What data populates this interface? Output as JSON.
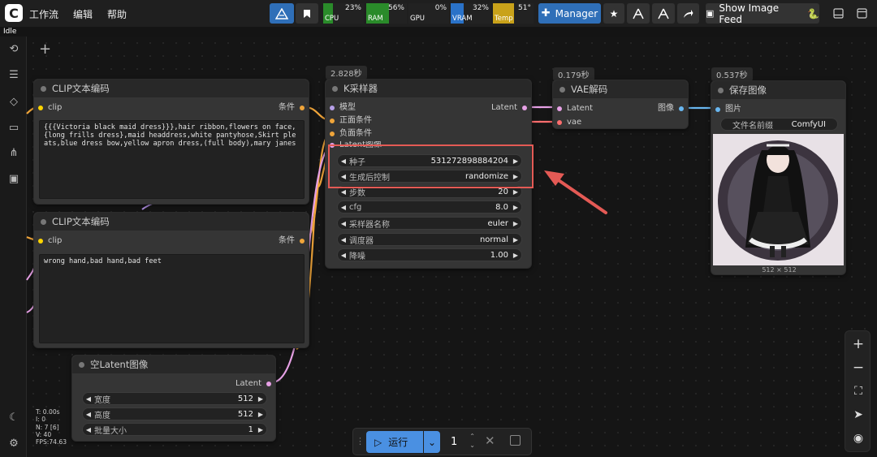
{
  "menu": [
    "工作流",
    "编辑",
    "帮助"
  ],
  "logo": "C",
  "status": "Idle",
  "resources": [
    {
      "label": "CPU",
      "pct": "23%",
      "fill": 0.23,
      "color": "#2a8b2a"
    },
    {
      "label": "RAM",
      "pct": "56%",
      "fill": 0.56,
      "color": "#2a8b2a"
    },
    {
      "label": "GPU",
      "pct": "0%",
      "fill": 0.0,
      "color": "#2a8b2a"
    },
    {
      "label": "VRAM",
      "pct": "32%",
      "fill": 0.32,
      "color": "#2a72c8"
    },
    {
      "label": "Temp",
      "pct": "51°",
      "fill": 0.51,
      "color": "#c9a21a"
    }
  ],
  "toolbar": {
    "manager_label": "Manager",
    "show_feed_label": "Show Image Feed",
    "feed_emoji": "🐍"
  },
  "nodes": {
    "clip1": {
      "title": "CLIP文本编码",
      "input": "clip",
      "output": "条件",
      "text": "{{{Victoria black maid dress}}},hair ribbon,flowers on face,{long frills dress},maid headdress,white pantyhose,Skirt pleats,blue dress bow,yellow apron dress,(full body),mary janes"
    },
    "clip2": {
      "title": "CLIP文本编码",
      "input": "clip",
      "output": "条件",
      "text": "wrong hand,bad hand,bad feet"
    },
    "ksampler": {
      "title": "K采样器",
      "time": "2.828秒",
      "inputs": [
        "模型",
        "正面条件",
        "负面条件",
        "Latent图像"
      ],
      "output": "Latent",
      "widgets": [
        {
          "label": "种子",
          "value": "531272898884204"
        },
        {
          "label": "生成后控制",
          "value": "randomize"
        },
        {
          "label": "步数",
          "value": "20"
        },
        {
          "label": "cfg",
          "value": "8.0"
        },
        {
          "label": "采样器名称",
          "value": "euler"
        },
        {
          "label": "调度器",
          "value": "normal"
        },
        {
          "label": "降噪",
          "value": "1.00"
        }
      ]
    },
    "vae": {
      "title": "VAE解码",
      "time": "0.179秒",
      "inputs": [
        "Latent",
        "vae"
      ],
      "output": "图像"
    },
    "save": {
      "title": "保存图像",
      "time": "0.537秒",
      "input": "图片",
      "prefix_label": "文件名前缀",
      "prefix_value": "ComfyUI",
      "image_size": "512 × 512"
    },
    "latent": {
      "title": "空Latent图像",
      "output": "Latent",
      "widgets": [
        {
          "label": "宽度",
          "value": "512"
        },
        {
          "label": "高度",
          "value": "512"
        },
        {
          "label": "批量大小",
          "value": "1"
        }
      ]
    }
  },
  "run": {
    "label": "运行",
    "count": "1"
  },
  "stats": [
    "T: 0.00s",
    "I: 0",
    "N: 7 [6]",
    "V: 40",
    "FPS:74.63"
  ],
  "colors": {
    "accent": "#3b7ed6",
    "highlight": "#e45a55",
    "link_orange": "#f0a53a",
    "link_pink": "#e7a1e6",
    "link_blue": "#69b7f0",
    "link_red": "#ff6e6e"
  }
}
